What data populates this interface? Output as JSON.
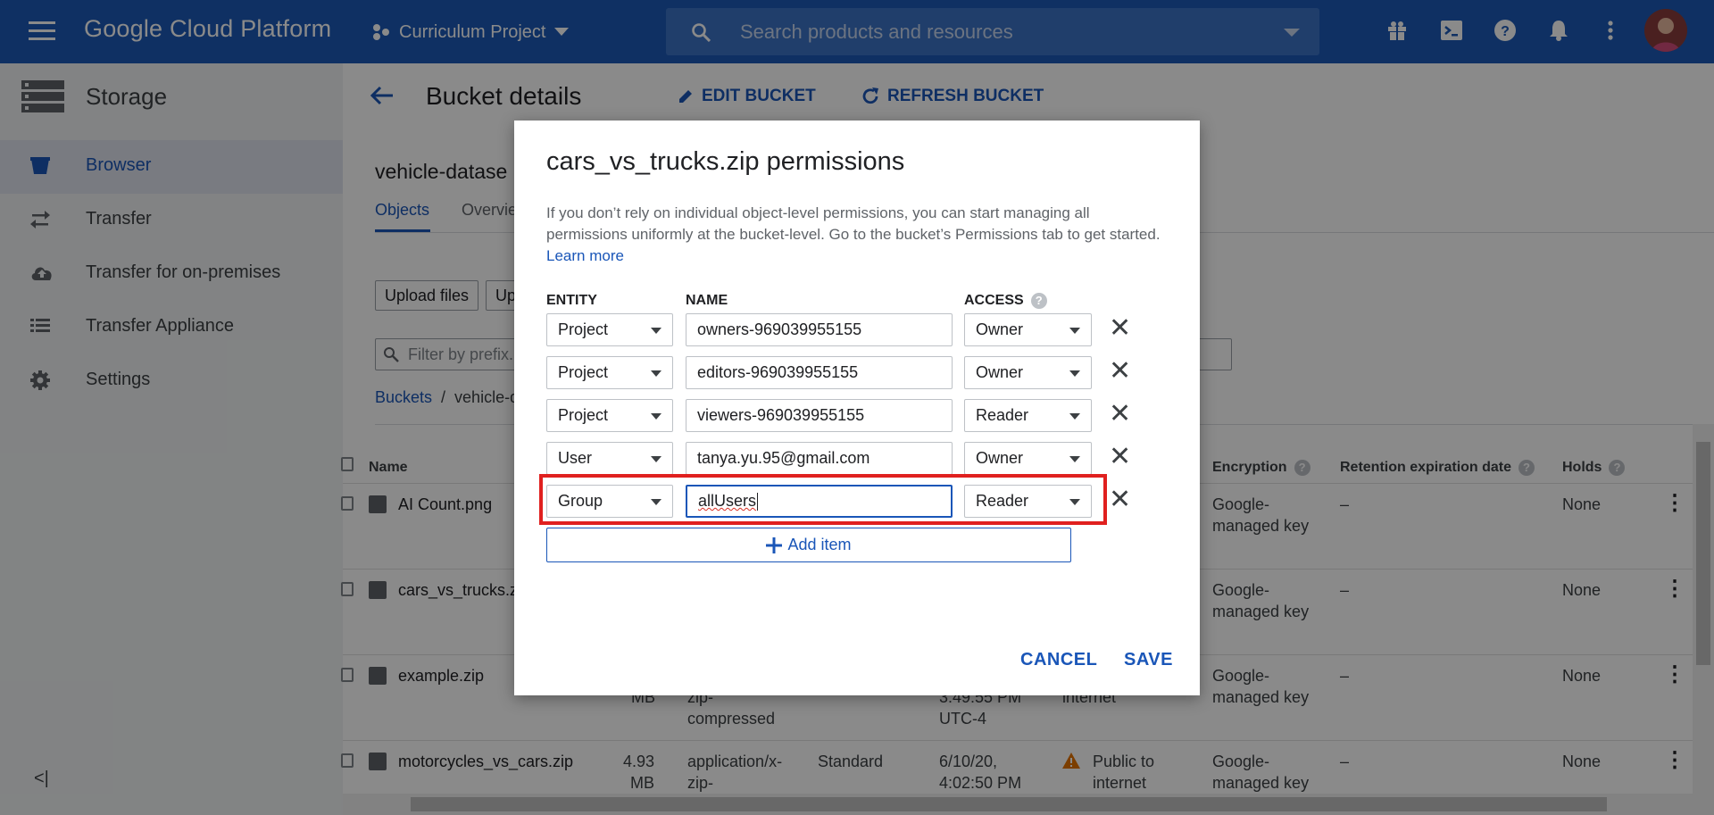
{
  "app": {
    "name": "Google Cloud Platform"
  },
  "header": {
    "project": "Curriculum Project",
    "search_placeholder": "Search products and resources"
  },
  "sidebar": {
    "title": "Storage",
    "items": [
      {
        "label": "Browser",
        "icon": "bucket-icon",
        "active": true
      },
      {
        "label": "Transfer",
        "icon": "transfer-arrows-icon"
      },
      {
        "label": "Transfer for on-premises",
        "icon": "cloud-upload-icon"
      },
      {
        "label": "Transfer Appliance",
        "icon": "list-icon"
      },
      {
        "label": "Settings",
        "icon": "gear-icon"
      }
    ]
  },
  "main": {
    "page_title": "Bucket details",
    "edit_bucket": "EDIT BUCKET",
    "refresh_bucket": "REFRESH BUCKET",
    "bucket_name": "vehicle-datase",
    "tabs": [
      "Objects",
      "Overvie"
    ],
    "upload_files": "Upload files",
    "upload_folder": "Up",
    "filter_placeholder": "Filter by prefix...",
    "breadcrumb": {
      "root": "Buckets",
      "sep": "/",
      "current": "vehicle-d"
    },
    "columns": {
      "name": "Name",
      "encryption": "Encryption",
      "retention": "Retention expiration date",
      "holds": "Holds"
    },
    "rows": [
      {
        "name": "AI Count.png",
        "encryption": "Google-\nmanaged key",
        "retention": "–",
        "holds": "None"
      },
      {
        "name": "cars_vs_trucks.z",
        "encryption": "Google-\nmanaged key",
        "retention": "–",
        "holds": "None"
      },
      {
        "name": "example.zip",
        "size": "MB",
        "type": "zip-\ncompressed",
        "created": "3:49:55 PM\nUTC-4",
        "public": "internet",
        "encryption": "Google-\nmanaged key",
        "retention": "–",
        "holds": "None"
      },
      {
        "name": "motorcycles_vs_cars.zip",
        "size": "4.93\nMB",
        "type": "application/x-\nzip-",
        "storage": "Standard",
        "created": "6/10/20,\n4:02:50 PM",
        "public": "Public to\ninternet",
        "encryption": "Google-\nmanaged key",
        "retention": "–",
        "holds": "None"
      }
    ]
  },
  "dialog": {
    "title": "cars_vs_trucks.zip permissions",
    "description": "If you don’t rely on individual object-level permissions, you can start managing all permissions uniformly at the bucket-level. Go to the bucket’s Permissions tab to get started.",
    "learn_more": "Learn more",
    "col_entity": "ENTITY",
    "col_name": "NAME",
    "col_access": "ACCESS",
    "entries": [
      {
        "entity": "Project",
        "name": "owners-969039955155",
        "access": "Owner"
      },
      {
        "entity": "Project",
        "name": "editors-969039955155",
        "access": "Owner"
      },
      {
        "entity": "Project",
        "name": "viewers-969039955155",
        "access": "Reader"
      },
      {
        "entity": "User",
        "name": "tanya.yu.95@gmail.com",
        "access": "Owner"
      },
      {
        "entity": "Group",
        "name": "allUsers",
        "access": "Reader"
      }
    ],
    "add_item": "Add item",
    "cancel": "CANCEL",
    "save": "SAVE"
  },
  "colors": {
    "accent": "#1a56b8",
    "topbar": "#1c5ab7",
    "highlight": "#e0201f"
  }
}
